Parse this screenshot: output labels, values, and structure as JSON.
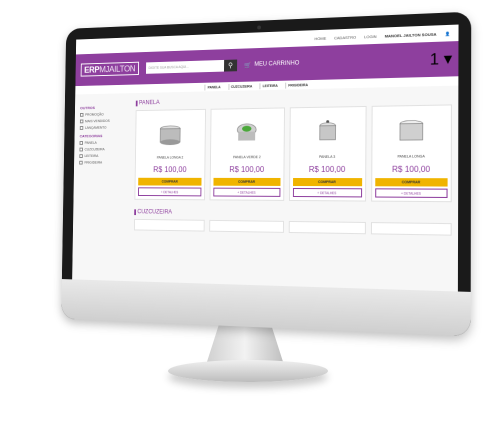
{
  "topbar": {
    "links": [
      "HOME",
      "CADASTRO",
      "LOGIN"
    ],
    "user": "MANOEL JAILTON SOUSA"
  },
  "header": {
    "logo_main": "ERP",
    "logo_sub": "MJAILTON",
    "search_placeholder": "DIGITE SUA BUSCA AQUI...",
    "cart_label": "MEU CARRINHO",
    "cart_qty": "1"
  },
  "nav": [
    "PANELA",
    "CUZCUZEIRA",
    "LEITEIRA",
    "FRIGIDEIRA"
  ],
  "sidebar": {
    "outros_title": "OUTROS",
    "outros": [
      "PROMOÇÃO",
      "MAIS VENDIDOS",
      "LANÇAMENTO"
    ],
    "categorias_title": "CATEGORIAS",
    "categorias": [
      "PANELA",
      "CUZCUZEIRA",
      "LEITEIRA",
      "FRIGIDEIRA"
    ]
  },
  "section1": {
    "title": "PANELA",
    "products": [
      {
        "name": "PANELA LONGA 2",
        "price": "R$ 100,00"
      },
      {
        "name": "PANELA VERDE 2",
        "price": "R$ 100,00"
      },
      {
        "name": "PANELA 3",
        "price": "R$ 100,00"
      },
      {
        "name": "PANELA LONGA",
        "price": "R$ 100,00"
      }
    ]
  },
  "buttons": {
    "buy": "COMPRAR",
    "details": "+ DETALHES"
  },
  "section2": {
    "title": "CUZCUZEIRA"
  },
  "colors": {
    "brand": "#8e3f9e",
    "buy": "#f0b400"
  }
}
